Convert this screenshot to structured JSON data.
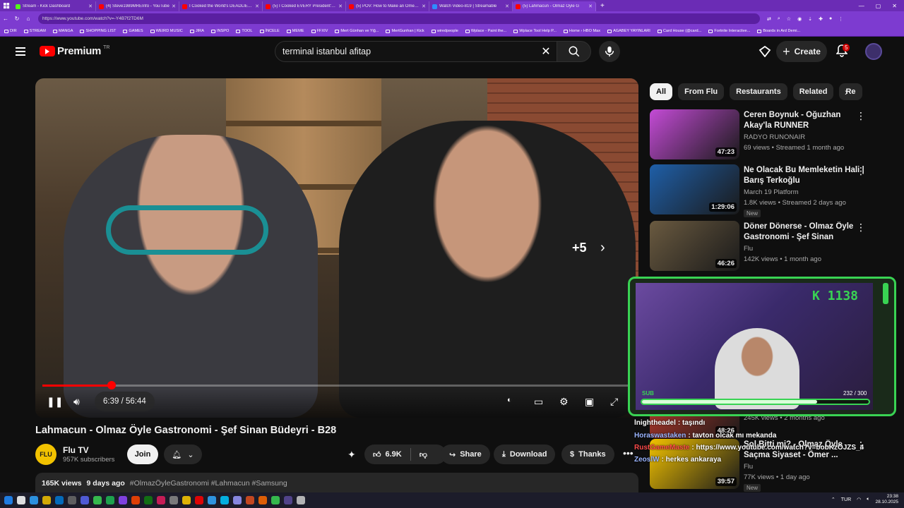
{
  "browser": {
    "tabs": [
      {
        "title": "Stream - Kick Dashboard",
        "color": "#53fc18",
        "active": false
      },
      {
        "title": "(4) Steve1989MREInfo - YouTube",
        "color": "#ff0000",
        "active": false
      },
      {
        "title": "I Cooked the World's DEADLIEST",
        "color": "#ff0000",
        "active": false
      },
      {
        "title": "(5) I Cooked EVERY President's Fa",
        "color": "#ff0000",
        "active": false
      },
      {
        "title": "(5) POV: How to Make an Omelett",
        "color": "#ff0000",
        "active": false
      },
      {
        "title": "Watch Video-819 | Streamable",
        "color": "#2f8cff",
        "active": false
      },
      {
        "title": "(5) Lahmacun - Olmaz Öyle G",
        "color": "#ff0000",
        "active": true
      }
    ],
    "url": "https://www.youtube.com/watch?v=-Y4B7f2TD6M",
    "bookmarks": [
      "DIR",
      "STREAM",
      "MANGA",
      "SHOPPING LIST",
      "GAMES",
      "WEIRD MUSIC",
      "JIRA",
      "INSPO",
      "TOOL",
      "İNCELE",
      "MEME",
      "FFXIV",
      "Mert Günhan ve Yiğ...",
      "MertGunhan | Kick",
      "wiredpeople",
      "Wplace - Paint the...",
      "Wplace Tool Help P...",
      "Home › HBO Max",
      "AGABEY YAYINLARI",
      "Card House (@card...",
      "Fortnite Interactive...",
      "Boards in Ard Demi..."
    ]
  },
  "header": {
    "logo_word": "Premium",
    "logo_region": "TR",
    "search_value": "terminal istanbul afitap",
    "create_label": "Create",
    "notif_count": "5"
  },
  "player": {
    "time": "6:39 / 56:44",
    "progress": 0.1174,
    "more_overlay": "+5"
  },
  "video": {
    "title": "Lahmacun - Olmaz Öyle Gastronomi - Şef Sinan Büdeyri - B28",
    "channel": "Flu TV",
    "channel_avatar_text": "FLU",
    "subscribers": "957K subscribers",
    "join_label": "Join",
    "likes": "6.9K",
    "share_label": "Share",
    "download_label": "Download",
    "thanks_label": "Thanks",
    "views": "165K views",
    "date": "9 days ago",
    "tags": "#OlmazÖyleGastronomi #Lahmacun #Samsung"
  },
  "chips": [
    "All",
    "From Flu",
    "Restaurants",
    "Related",
    "Re"
  ],
  "recommendations": [
    {
      "title": "Ceren Boynuk - Oğuzhan Akay'la RUNNER",
      "channel": "RADYO RUNONAIR",
      "meta": "69 views • Streamed 1 month ago",
      "duration": "47:23",
      "badge": "",
      "thumb_color": "#c44bd6"
    },
    {
      "title": "Ne Olacak Bu Memleketin Hali | Barış Terkoğlu",
      "channel": "March 19 Platform",
      "meta": "1.8K views • Streamed 2 days ago",
      "duration": "1:29:06",
      "badge": "New",
      "thumb_color": "#1f5fa8"
    },
    {
      "title": "Döner Dönerse - Olmaz Öyle Gastronomi - Şef Sinan Büdeyr...",
      "channel": "Flu",
      "meta": "142K views • 1 month ago",
      "duration": "46:26",
      "badge": "",
      "thumb_color": "#6a5a40"
    },
    {
      "title": "",
      "channel": "",
      "meta": "245K views • 2 months ago",
      "duration": "48:26",
      "badge": "",
      "thumb_color": "#c0392b"
    },
    {
      "title": "Sol Bitti mi? - Olmaz Öyle Saçma Siyaset - Ömer ...",
      "channel": "Flu",
      "meta": "77K views • 1 day ago",
      "duration": "39:57",
      "badge": "New",
      "thumb_color": "#f2c200"
    }
  ],
  "stream_overlay": {
    "k_count": "K 1138",
    "sub_label": "SUB",
    "sub_count": "232 / 300",
    "sub_progress": 0.7733
  },
  "chat": [
    {
      "user": "lnightheadel",
      "msg": ": taşındı",
      "color": "#ffffff"
    },
    {
      "user": "Horaswastaken",
      "msg": ": tavton olcak mı mekanda",
      "color": "#9ab4ff"
    },
    {
      "user": "RustGameMaste",
      "msg": ": https://www.youtube.com/watch?v=bobKzOJZS_4",
      "color": "#ff4a4a"
    },
    {
      "user": "ZeoslW",
      "msg": ": herkes ankaraya",
      "color": "#9ab4ff"
    }
  ],
  "taskbar": {
    "lang": "TUR",
    "time": "23:38",
    "date": "28.10.2025"
  }
}
